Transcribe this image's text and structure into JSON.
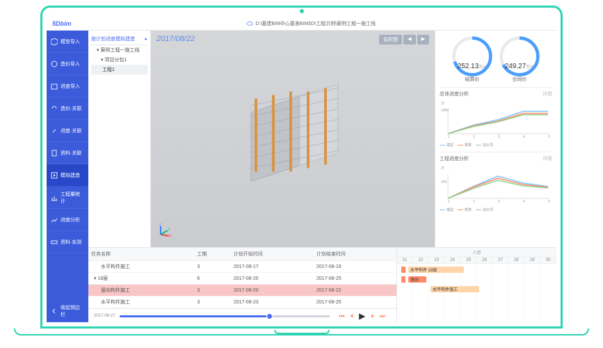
{
  "logo": "5Dbim",
  "breadcrumb": "D:\\基建BIM中心基准BIM5D\\工程示例\\案例工程一施工线",
  "sidebar": {
    "items": [
      {
        "label": "模型导入"
      },
      {
        "label": "造价导入"
      },
      {
        "label": "进度导入"
      },
      {
        "label": "造价·关联"
      },
      {
        "label": "进度·关联"
      },
      {
        "label": "资料·关联"
      },
      {
        "label": "模拟建造"
      },
      {
        "label": "工程量统计"
      },
      {
        "label": "进度分析"
      },
      {
        "label": "资料·实测"
      }
    ],
    "bottom": "收起侧边栏"
  },
  "tree": {
    "title": "按计划进度模拟建造",
    "root": "案例工程一施工线",
    "child": "项目分包1",
    "leaf": "工程1"
  },
  "viewport": {
    "date": "2017/08/22",
    "btn": "实时图"
  },
  "gauges": [
    {
      "value": "252.13",
      "unit": "万元",
      "label": "结算价"
    },
    {
      "value": "249.27",
      "unit": "万元",
      "label": "合同价"
    }
  ],
  "charts": [
    {
      "title": "总体进度分析",
      "ylabel": "万",
      "more": "详情"
    },
    {
      "title": "工程进度分析",
      "ylabel": "万",
      "more": "详情"
    }
  ],
  "chart_data": [
    {
      "type": "line",
      "title": "总体进度分析",
      "xlabel": "",
      "ylabel": "万",
      "x": [
        1,
        2,
        3,
        4,
        5
      ],
      "ylim": [
        0,
        1000
      ],
      "series": [
        {
          "name": "模型",
          "color": "#7cc4ff",
          "values": [
            0,
            300,
            520,
            820,
            820
          ]
        },
        {
          "name": "概算",
          "color": "#ff8a65",
          "values": [
            0,
            280,
            480,
            760,
            760
          ]
        },
        {
          "name": "造价员",
          "color": "#8ed18e",
          "values": [
            0,
            260,
            450,
            720,
            720
          ]
        }
      ]
    },
    {
      "type": "line",
      "title": "工程进度分析",
      "xlabel": "",
      "ylabel": "万",
      "x": [
        1,
        2,
        3,
        4,
        5
      ],
      "ylim": [
        0,
        250
      ],
      "series": [
        {
          "name": "模型",
          "color": "#7cc4ff",
          "values": [
            0,
            120,
            220,
            160,
            130
          ]
        },
        {
          "name": "概算",
          "color": "#ff8a65",
          "values": [
            0,
            110,
            200,
            150,
            120
          ]
        },
        {
          "name": "造价员",
          "color": "#8ed18e",
          "values": [
            0,
            100,
            180,
            140,
            115
          ]
        }
      ]
    }
  ],
  "legend_items": [
    "模型",
    "概算",
    "造价员"
  ],
  "table": {
    "headers": [
      "任务名称",
      "工期",
      "计划开始时间",
      "计划结束时间"
    ],
    "rows": [
      {
        "name": "水平构件施工",
        "dur": "3",
        "start": "2017-08-17",
        "end": "2017-08-19",
        "indent": true
      },
      {
        "name": "18层",
        "dur": "6",
        "start": "2017-08-20",
        "end": "2017-08-25",
        "group": true
      },
      {
        "name": "竖向构件施工",
        "dur": "3",
        "start": "2017-08-20",
        "end": "2017-08-22",
        "hl": true,
        "indent": true
      },
      {
        "name": "水平构件施工",
        "dur": "3",
        "start": "2017-08-23",
        "end": "2017-08-25",
        "indent": true
      }
    ]
  },
  "timeline": {
    "date": "2017-06-27"
  },
  "controls": {
    "prev2": "⏮",
    "prev": "◀",
    "play": "▶",
    "next": "▶",
    "next2": "⏭"
  },
  "gantt": {
    "month": "八月",
    "days": [
      "21",
      "22",
      "23",
      "24",
      "25",
      "26",
      "27",
      "28",
      "29",
      "30"
    ],
    "bars": [
      {
        "label": "水平构件 18层"
      },
      {
        "label": "竖向"
      },
      {
        "label": "水平构件施工"
      }
    ]
  }
}
